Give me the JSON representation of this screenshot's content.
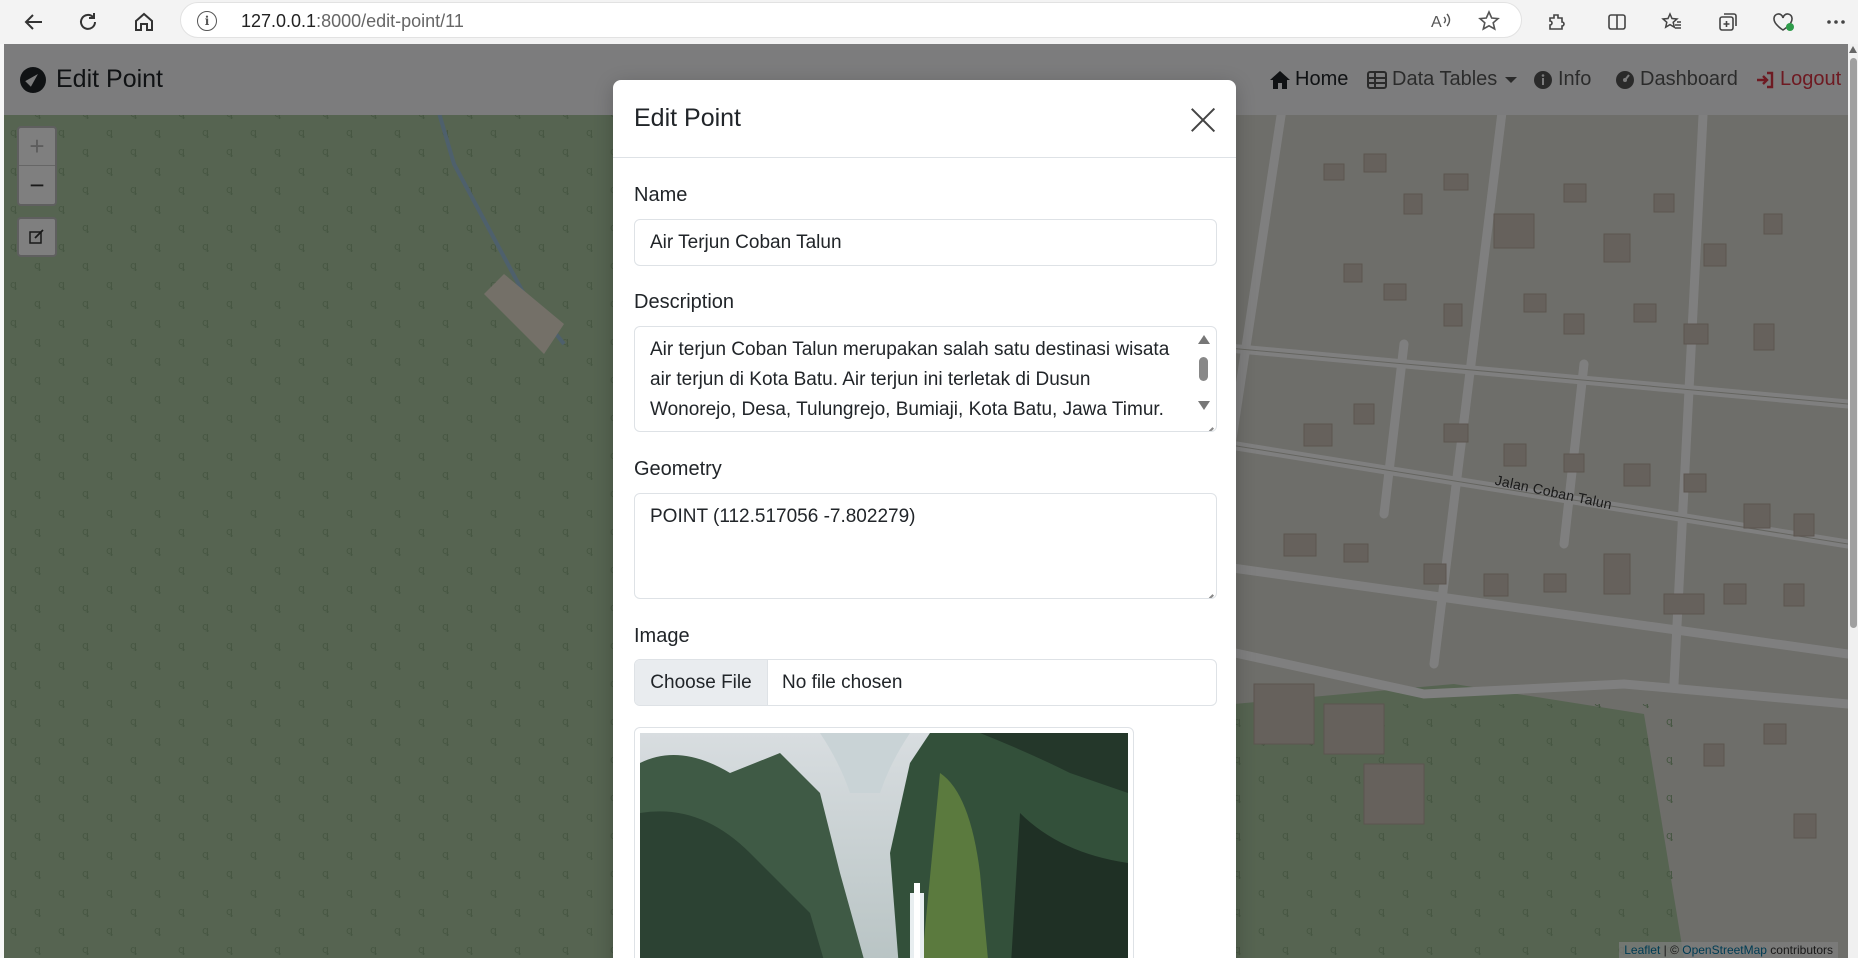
{
  "browser": {
    "url_host": "127.0.0.1",
    "url_rest": ":8000/edit-point/11"
  },
  "navbar": {
    "brand": "Edit Point",
    "links": {
      "home": "Home",
      "data_tables": "Data Tables",
      "info": "Info",
      "dashboard": "Dashboard",
      "logout": "Logout"
    }
  },
  "map": {
    "street_label": "Jalan Coban Talun",
    "attribution_leaflet": "Leaflet",
    "attribution_sep": " | © ",
    "attribution_osm": "OpenStreetMap",
    "attribution_rest": " contributors"
  },
  "modal": {
    "title": "Edit Point",
    "name_label": "Name",
    "name_value": "Air Terjun Coban Talun",
    "description_label": "Description",
    "description_value": "Air terjun Coban Talun merupakan salah satu destinasi wisata air terjun di Kota Batu. Air terjun ini terletak di Dusun Wonorejo, Desa, Tulungrejo, Bumiaji, Kota Batu, Jawa Timur.",
    "geometry_label": "Geometry",
    "geometry_value": "POINT (112.517056 -7.802279)",
    "image_label": "Image",
    "file_button": "Choose File",
    "file_status": "No file chosen"
  }
}
